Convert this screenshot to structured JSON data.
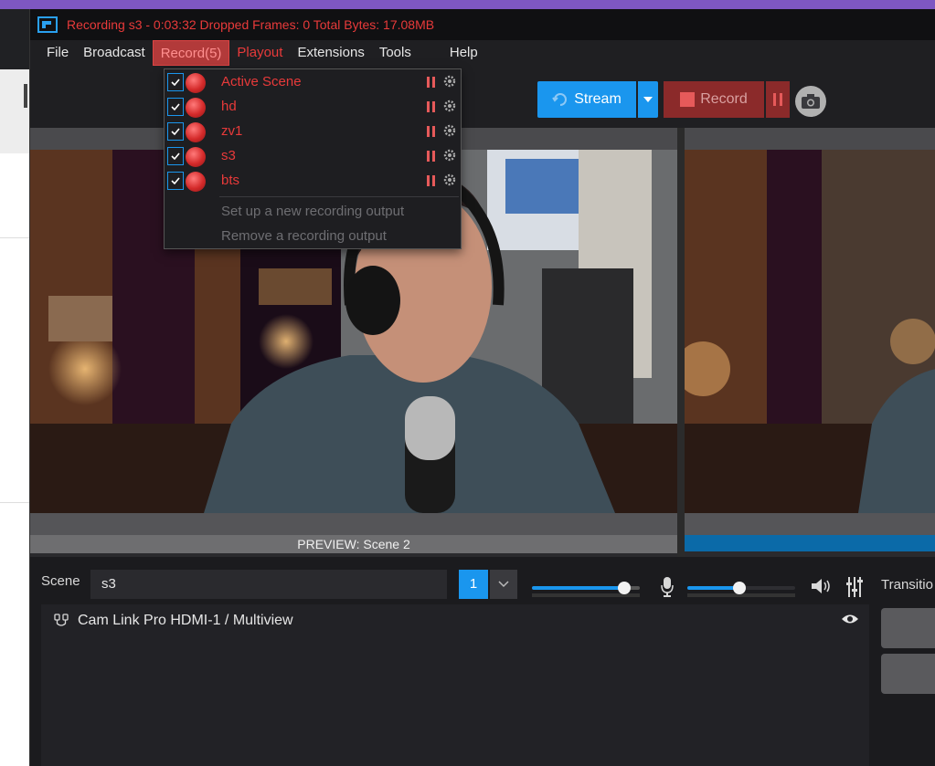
{
  "window": {
    "title": "Recording s3 - 0:03:32  Dropped Frames: 0  Total Bytes: 17.08MB"
  },
  "menu": {
    "items": [
      "File",
      "Broadcast",
      "Record(5)",
      "Playout",
      "Extensions",
      "Tools",
      "Help"
    ]
  },
  "toolbar": {
    "stream_label": "Stream",
    "record_label": "Record"
  },
  "record_menu": {
    "outputs": [
      {
        "label": "Active Scene",
        "checked": true
      },
      {
        "label": "hd",
        "checked": true
      },
      {
        "label": "zv1",
        "checked": true
      },
      {
        "label": "s3",
        "checked": true
      },
      {
        "label": "bts",
        "checked": true
      }
    ],
    "actions": [
      "Set up a new recording output",
      "Remove a recording output"
    ]
  },
  "preview": {
    "label": "PREVIEW:  Scene 2"
  },
  "controls": {
    "scene_label": "Scene",
    "scene_value": "s3",
    "scene_number": "1",
    "volume1": 0.88,
    "volume2": 0.48,
    "transition_label": "Transitio"
  },
  "sources": {
    "items": [
      {
        "name": "Cam Link Pro HDMI-1 / Multiview",
        "visible": true
      }
    ]
  },
  "colors": {
    "accent": "#1a96ee",
    "recording_red": "#e83a3a",
    "record_button": "#8b2a2a",
    "background": "#1b1b1e"
  },
  "icons": [
    "app-logo-icon",
    "stream-icon",
    "chevron-down-icon",
    "pause-icon",
    "camera-icon",
    "check-icon",
    "record-dot-icon",
    "gear-icon",
    "mic-icon",
    "speaker-icon",
    "mixer-icon",
    "plug-icon",
    "eye-icon"
  ]
}
